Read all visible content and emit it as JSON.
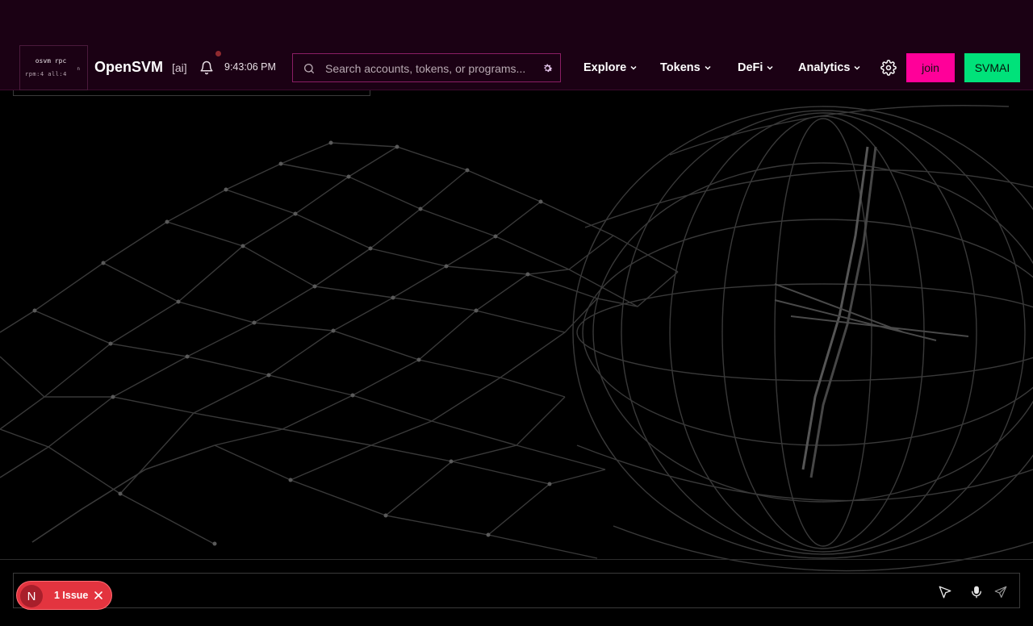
{
  "rpc": {
    "title": "osvm rpc",
    "stats": "rpm:4 all:4",
    "indicator": "n"
  },
  "brand": {
    "name": "OpenSVM",
    "tag": "[ai]"
  },
  "notifications": {
    "icon": "bell-icon",
    "has_unread": true
  },
  "clock": "9:43:06 PM",
  "search": {
    "placeholder": "Search accounts, tokens, or programs...",
    "value": "",
    "settings_icon": "gear-icon"
  },
  "nav": [
    {
      "label": "Explore"
    },
    {
      "label": "Tokens"
    },
    {
      "label": "DeFi"
    },
    {
      "label": "Analytics"
    }
  ],
  "settings_icon": "gear-icon",
  "join_label": "join",
  "svmai_label": "SVMAI",
  "chat": {
    "placeholder": "",
    "icons": [
      "cursor-icon",
      "microphone-icon",
      "send-icon"
    ]
  },
  "issue": {
    "avatar": "N",
    "label": "1 Issue"
  },
  "colors": {
    "header_bg": "#1b0114",
    "accent_pink": "#ff0099",
    "accent_green": "#00e27a",
    "issue_red": "#e3343f"
  }
}
